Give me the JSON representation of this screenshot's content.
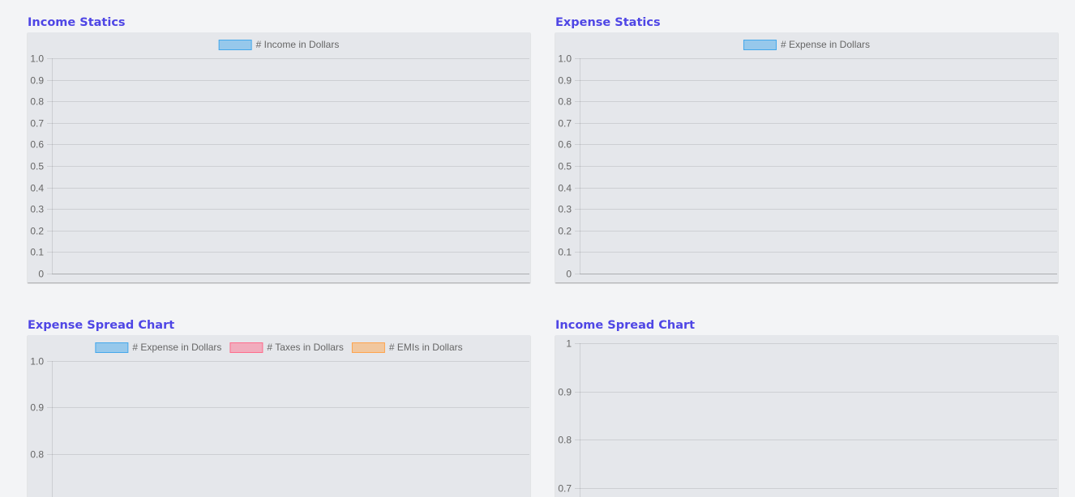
{
  "chart_data": [
    {
      "id": "income-statics",
      "type": "bar",
      "title": "Income Statics",
      "legend_position": "top",
      "grid": true,
      "ylim": [
        0,
        1
      ],
      "yticks": [
        "1.0",
        "0.9",
        "0.8",
        "0.7",
        "0.6",
        "0.5",
        "0.4",
        "0.3",
        "0.2",
        "0.1",
        "0"
      ],
      "categories": [],
      "series": [
        {
          "name": "# Income in Dollars",
          "values": [],
          "color": "#36a2eb"
        }
      ]
    },
    {
      "id": "expense-statics",
      "type": "bar",
      "title": "Expense Statics",
      "legend_position": "top",
      "grid": true,
      "ylim": [
        0,
        1
      ],
      "yticks": [
        "1.0",
        "0.9",
        "0.8",
        "0.7",
        "0.6",
        "0.5",
        "0.4",
        "0.3",
        "0.2",
        "0.1",
        "0"
      ],
      "categories": [],
      "series": [
        {
          "name": "# Expense in Dollars",
          "values": [],
          "color": "#36a2eb"
        }
      ]
    },
    {
      "id": "expense-spread-chart",
      "type": "bar",
      "title": "Expense Spread Chart",
      "legend_position": "top",
      "grid": true,
      "ylim": [
        0,
        1
      ],
      "yticks": [
        "1.0",
        "0.9",
        "0.8"
      ],
      "categories": [],
      "series": [
        {
          "name": "# Expense in Dollars",
          "values": [],
          "color": "#36a2eb"
        },
        {
          "name": "# Taxes in Dollars",
          "values": [],
          "color": "#ff6384"
        },
        {
          "name": "# EMIs in Dollars",
          "values": [],
          "color": "#ff9f40"
        }
      ]
    },
    {
      "id": "income-spread-chart",
      "type": "bar",
      "title": "Income Spread Chart",
      "legend_position": "none",
      "grid": true,
      "ylim": [
        0,
        1
      ],
      "yticks": [
        "1",
        "0.9",
        "0.8",
        "0.7"
      ],
      "categories": [],
      "series": []
    }
  ]
}
